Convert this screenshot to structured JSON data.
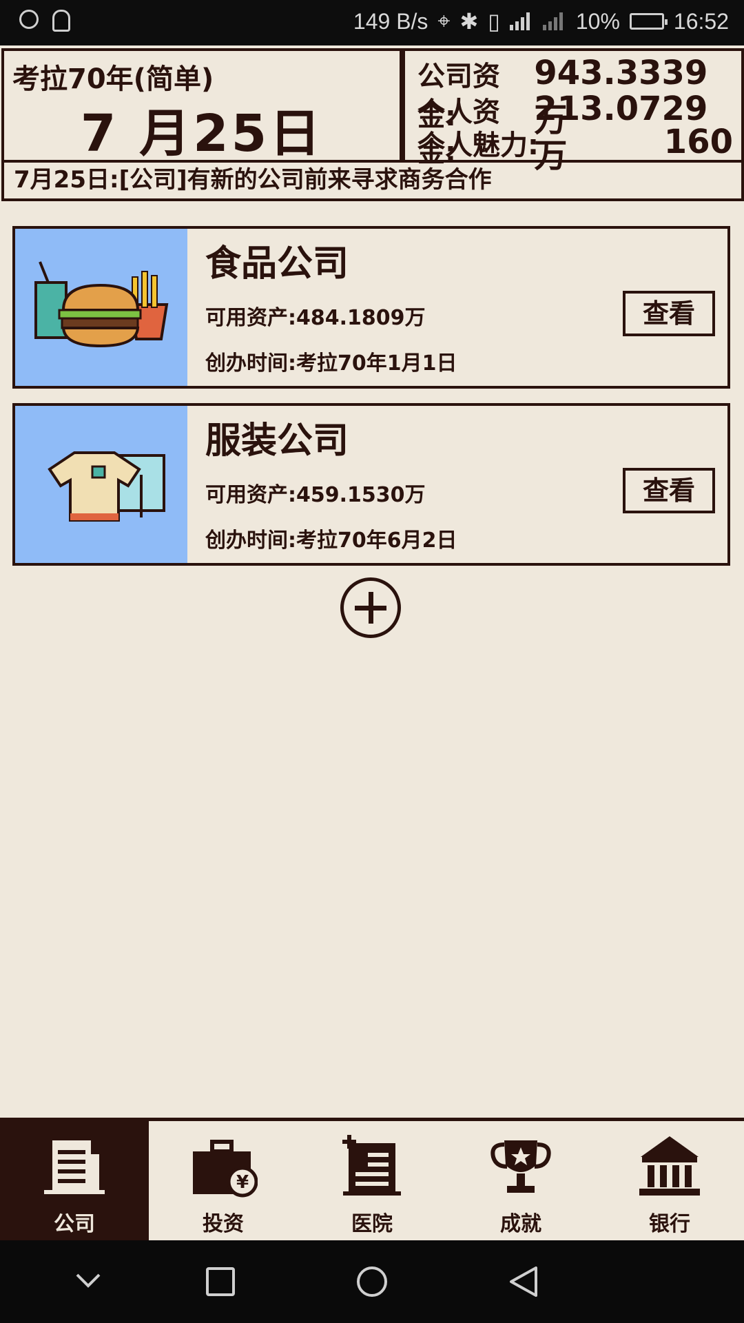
{
  "status_bar": {
    "network_speed": "149 B/s",
    "battery": "10%",
    "time": "16:52"
  },
  "header": {
    "game_mode": "考拉70年(简单)",
    "date": "7 月25日"
  },
  "finance": {
    "company_funds_label": "公司资金:",
    "company_funds_value": "943.3339万",
    "personal_funds_label": "个人资金:",
    "personal_funds_value": "213.0729万",
    "charisma_label": "个人魅力:",
    "charisma_value": "160"
  },
  "news_ticker": "7月25日:[公司]有新的公司前来寻求商务合作",
  "companies": [
    {
      "name": "食品公司",
      "assets": "可用资产:484.1809万",
      "founded": "创办时间:考拉70年1月1日",
      "view_label": "查看",
      "icon": "food-icon"
    },
    {
      "name": "服装公司",
      "assets": "可用资产:459.1530万",
      "founded": "创办时间:考拉70年6月2日",
      "view_label": "查看",
      "icon": "clothing-icon"
    }
  ],
  "bottom_nav": [
    {
      "label": "公司",
      "icon": "building-icon",
      "active": true
    },
    {
      "label": "投资",
      "icon": "briefcase-icon",
      "active": false
    },
    {
      "label": "医院",
      "icon": "hospital-icon",
      "active": false
    },
    {
      "label": "成就",
      "icon": "trophy-icon",
      "active": false
    },
    {
      "label": "银行",
      "icon": "bank-icon",
      "active": false
    }
  ],
  "colors": {
    "background": "#efe8dc",
    "ink": "#2a120d",
    "thumb_blue": "#8fbbf7"
  }
}
